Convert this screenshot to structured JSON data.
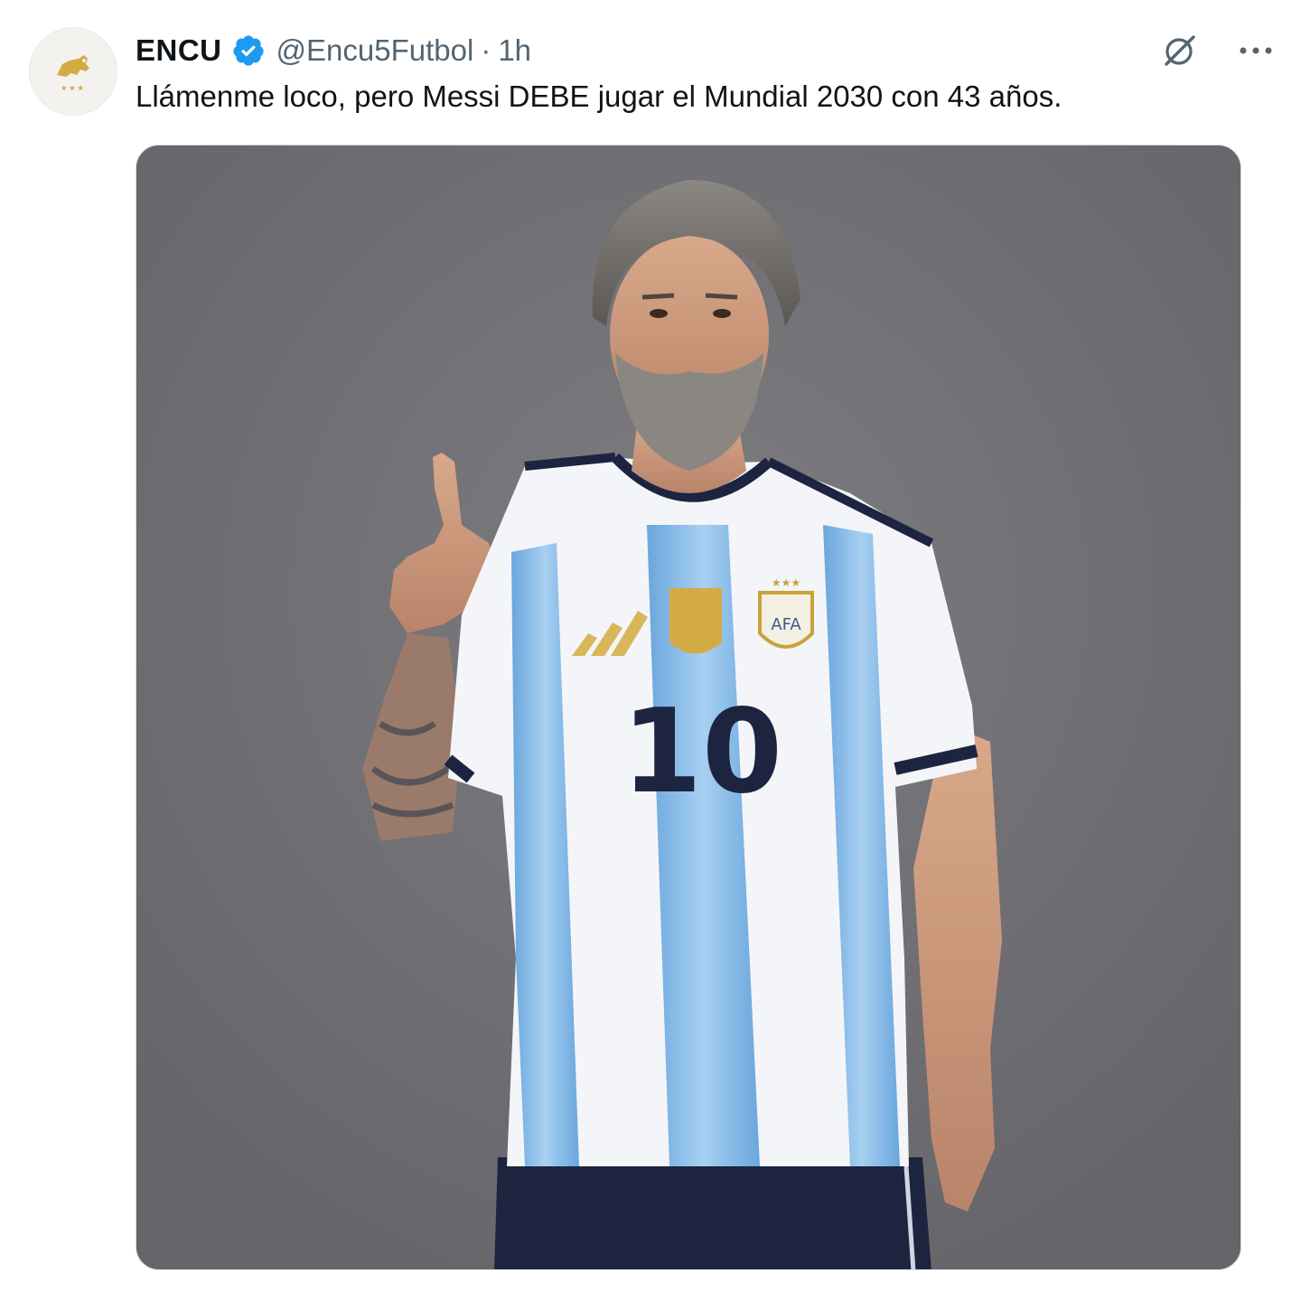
{
  "tweet": {
    "author": {
      "display_name": "ENCU",
      "handle": "@Encu5Futbol",
      "verified": true,
      "avatar_icon": "lion-logo-icon"
    },
    "separator": "·",
    "timestamp": "1h",
    "text": "Llámenme loco, pero Messi DEBE jugar el Mundial 2030 con 43 años.",
    "actions": {
      "grok_icon": "grok-icon",
      "more_icon": "more-options-icon"
    },
    "media": {
      "shirt_number": "10"
    }
  },
  "colors": {
    "verified_blue": "#1d9bf0",
    "text_primary": "#0f1419",
    "text_secondary": "#536471",
    "photo_background": "#6f6e72",
    "jersey_sky_blue": "#8fc0ea",
    "jersey_navy": "#1c2440"
  }
}
